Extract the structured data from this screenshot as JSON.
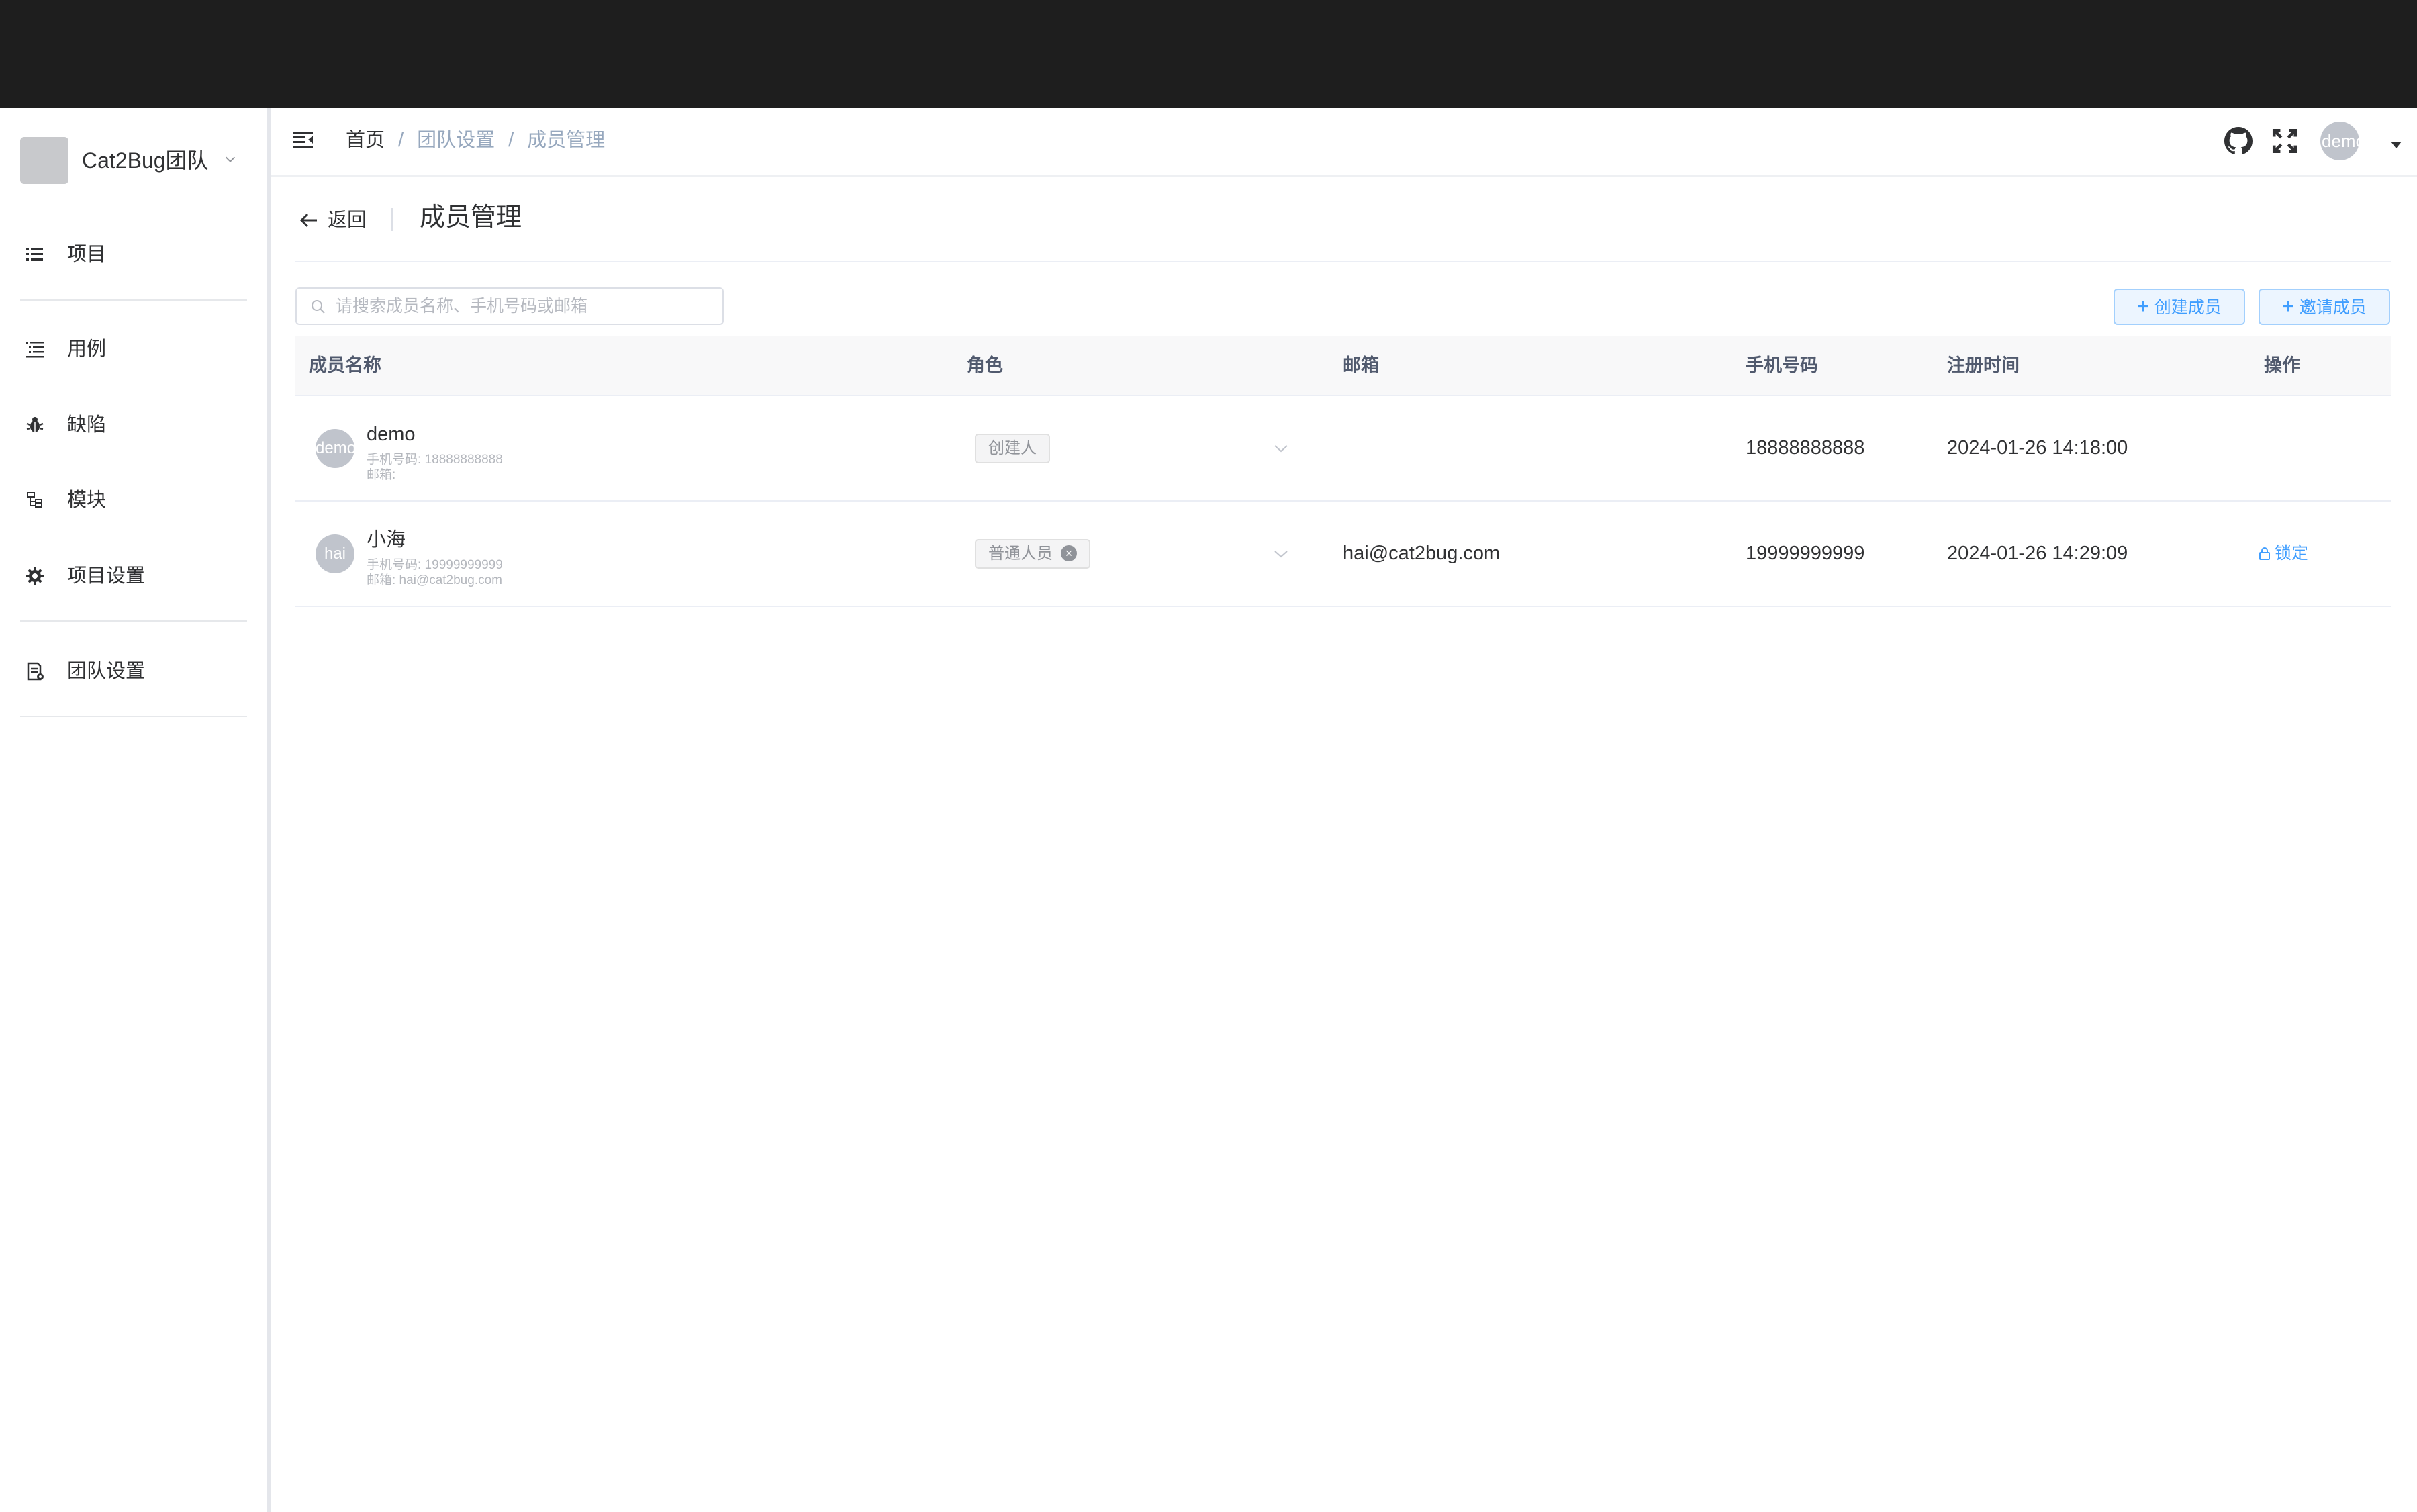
{
  "team": {
    "name": "Cat2Bug团队"
  },
  "sidebar": {
    "items": [
      {
        "label": "项目",
        "icon": "list-icon"
      },
      {
        "label": "用例",
        "icon": "case-list-icon"
      },
      {
        "label": "缺陷",
        "icon": "bug-icon"
      },
      {
        "label": "模块",
        "icon": "tree-icon"
      },
      {
        "label": "项目设置",
        "icon": "gear-icon"
      },
      {
        "label": "团队设置",
        "icon": "team-settings-icon"
      }
    ]
  },
  "header": {
    "breadcrumb": [
      "首页",
      "团队设置",
      "成员管理"
    ],
    "avatar_text": "demo",
    "icons": [
      "github-icon",
      "fullscreen-icon"
    ]
  },
  "page": {
    "back_label": "返回",
    "title": "成员管理"
  },
  "toolbar": {
    "search_placeholder": "请搜索成员名称、手机号码或邮箱",
    "create_label": "创建成员",
    "invite_label": "邀请成员"
  },
  "table": {
    "columns": [
      "成员名称",
      "角色",
      "邮箱",
      "手机号码",
      "注册时间",
      "操作"
    ],
    "rows": [
      {
        "avatar": "demo",
        "name": "demo",
        "phone_line": "手机号码: 18888888888",
        "email_line": "邮箱:",
        "role": "创建人",
        "email": "",
        "phone": "18888888888",
        "registered": "2024-01-26 14:18:00",
        "action": ""
      },
      {
        "avatar": "hai",
        "name": "小海",
        "phone_line": "手机号码: 19999999999",
        "email_line": "邮箱: hai@cat2bug.com",
        "role": "普通人员",
        "email": "hai@cat2bug.com",
        "phone": "19999999999",
        "registered": "2024-01-26 14:29:09",
        "action": "锁定"
      }
    ]
  },
  "colors": {
    "accent": "#409eff",
    "topbar": "#1e1e1e",
    "breadcrumb_muted": "#97a8be"
  }
}
